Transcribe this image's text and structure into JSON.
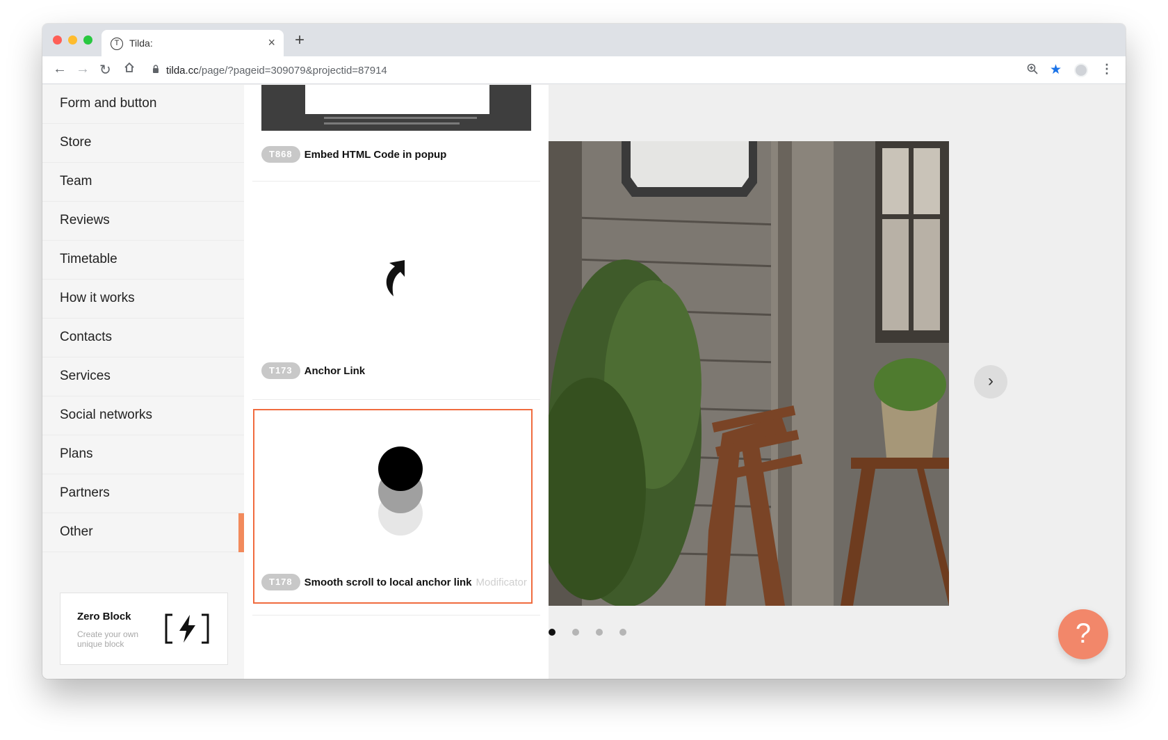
{
  "browser": {
    "tab_title": "Tilda:",
    "tab_favicon": "T",
    "tab_close": "×",
    "new_tab": "+",
    "url_host": "tilda.cc",
    "url_path": "/page/?pageid=309079&projectid=87914"
  },
  "sidebar": {
    "items": [
      {
        "label": "Form and button"
      },
      {
        "label": "Store"
      },
      {
        "label": "Team"
      },
      {
        "label": "Reviews"
      },
      {
        "label": "Timetable"
      },
      {
        "label": "How it works"
      },
      {
        "label": "Contacts"
      },
      {
        "label": "Services"
      },
      {
        "label": "Social networks"
      },
      {
        "label": "Plans"
      },
      {
        "label": "Partners"
      },
      {
        "label": "Other",
        "active": true
      }
    ],
    "zero_block": {
      "title": "Zero Block",
      "description": "Create your own unique block"
    }
  },
  "blocks": [
    {
      "code": "T868",
      "name": "Embed HTML Code in popup"
    },
    {
      "code": "T173",
      "name": "Anchor Link"
    },
    {
      "code": "T178",
      "name": "Smooth scroll to local anchor link",
      "modifier": "Modificator",
      "selected": true
    }
  ],
  "preview": {
    "next_label": "›",
    "slides": 4,
    "active_slide": 1,
    "help_label": "?"
  },
  "colors": {
    "accent": "#f28a5c",
    "selected_border": "#f06b3e",
    "help_button": "#f2876a",
    "bookmark_star": "#1a73e8"
  }
}
